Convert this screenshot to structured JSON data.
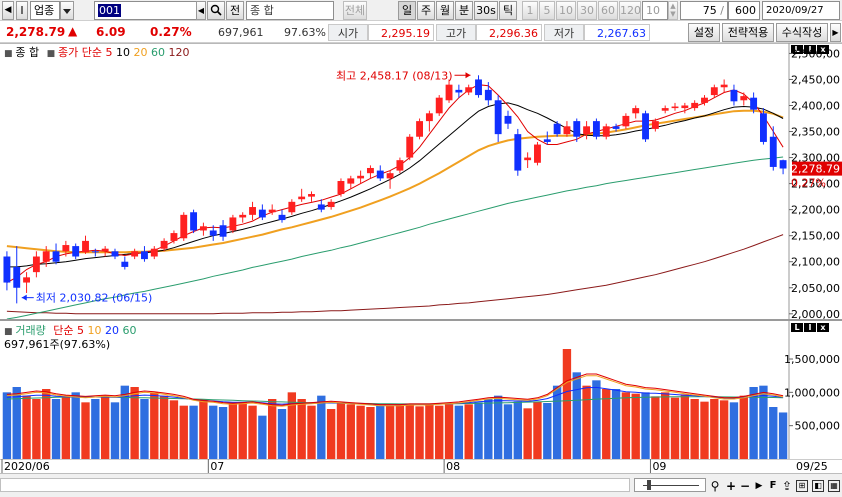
{
  "toolbar": {
    "mode_label": "I",
    "market_label": "업종",
    "code": "001",
    "name_field": "종          합",
    "all_label": "전체",
    "periods": [
      "일",
      "주",
      "월",
      "분",
      "30s",
      "틱"
    ],
    "intervals": [
      "1",
      "5",
      "10",
      "30",
      "60",
      "120"
    ],
    "count_stepper": "10",
    "ratio_field": "75",
    "bars_field": "600",
    "date_field": "2020/09/27"
  },
  "quote": {
    "price": "2,278.79",
    "change": "6.09",
    "change_pct": "0.27%",
    "volume": "697,961",
    "volume_pct": "97.63%",
    "open_label": "시가",
    "open": "2,295.19",
    "high_label": "고가",
    "high": "2,296.36",
    "low_label": "저가",
    "low": "2,267.63"
  },
  "actions": {
    "settings": "설정",
    "apply_strategy": "전략적용",
    "write_formula": "수식작성"
  },
  "price_panel": {
    "legend_title": "종     합",
    "legend_ma": "종가 단순",
    "ma_periods": [
      "5",
      "10",
      "20",
      "60",
      "120"
    ],
    "high_note": "최고 2,458.17 (08/13)",
    "low_note": "최저 2,030.82 (06/15)",
    "last_price_tag": "2,278.79",
    "last_pct_tag": "0.27%",
    "y_ticks": [
      "2,500,00",
      "2,450,00",
      "2,400,00",
      "2,350,00",
      "2,300,00",
      "2,250,00",
      "2,200,00",
      "2,150,00",
      "2,100,00",
      "2,050,00",
      "2,000,00"
    ]
  },
  "volume_panel": {
    "legend_title": "거래량",
    "legend_ma": "단순",
    "ma_periods": [
      "5",
      "10",
      "20",
      "60"
    ],
    "current_note": "697,961주(97.63%)",
    "y_ticks": [
      "1,500,000",
      "1,000,000",
      "500,000"
    ]
  },
  "x_axis": {
    "labels": [
      "2020/06",
      "07",
      "08",
      "09"
    ],
    "end_label": "09/25"
  },
  "colors": {
    "up": "#ff2020",
    "down": "#1030ff",
    "ma5": "#e00000",
    "ma10": "#000000",
    "ma20": "#f0a020",
    "ma60": "#2a9d6e",
    "ma120": "#8b1a1a",
    "vol_up": "#f03a20",
    "vol_down": "#2f6ee0"
  },
  "chart_data": {
    "type": "candlestick",
    "ylim": [
      1990,
      2520
    ],
    "candles": [
      [
        2110,
        2120,
        2045,
        2060
      ],
      [
        2090,
        2130,
        2020,
        2050
      ],
      [
        2060,
        2080,
        2040,
        2070
      ],
      [
        2080,
        2120,
        2070,
        2110
      ],
      [
        2100,
        2130,
        2090,
        2120
      ],
      [
        2120,
        2135,
        2095,
        2100
      ],
      [
        2120,
        2140,
        2110,
        2132
      ],
      [
        2130,
        2135,
        2105,
        2110
      ],
      [
        2118,
        2150,
        2115,
        2140
      ],
      [
        2120,
        2125,
        2110,
        2118
      ],
      [
        2120,
        2130,
        2110,
        2125
      ],
      [
        2120,
        2125,
        2105,
        2110
      ],
      [
        2100,
        2110,
        2085,
        2090
      ],
      [
        2110,
        2125,
        2105,
        2120
      ],
      [
        2120,
        2130,
        2100,
        2105
      ],
      [
        2110,
        2130,
        2105,
        2125
      ],
      [
        2125,
        2145,
        2120,
        2140
      ],
      [
        2140,
        2160,
        2135,
        2155
      ],
      [
        2145,
        2195,
        2140,
        2190
      ],
      [
        2195,
        2200,
        2155,
        2160
      ],
      [
        2160,
        2175,
        2150,
        2168
      ],
      [
        2160,
        2170,
        2140,
        2150
      ],
      [
        2170,
        2180,
        2140,
        2148
      ],
      [
        2160,
        2190,
        2155,
        2185
      ],
      [
        2185,
        2195,
        2175,
        2190
      ],
      [
        2190,
        2215,
        2180,
        2205
      ],
      [
        2200,
        2210,
        2180,
        2185
      ],
      [
        2195,
        2210,
        2190,
        2200
      ],
      [
        2190,
        2200,
        2175,
        2180
      ],
      [
        2195,
        2220,
        2190,
        2215
      ],
      [
        2220,
        2240,
        2215,
        2225
      ],
      [
        2225,
        2235,
        2215,
        2230
      ],
      [
        2210,
        2220,
        2195,
        2200
      ],
      [
        2205,
        2220,
        2200,
        2215
      ],
      [
        2230,
        2260,
        2225,
        2255
      ],
      [
        2250,
        2265,
        2240,
        2260
      ],
      [
        2260,
        2275,
        2250,
        2265
      ],
      [
        2270,
        2285,
        2260,
        2280
      ],
      [
        2275,
        2285,
        2255,
        2260
      ],
      [
        2260,
        2275,
        2240,
        2270
      ],
      [
        2275,
        2300,
        2270,
        2295
      ],
      [
        2300,
        2345,
        2295,
        2340
      ],
      [
        2340,
        2375,
        2335,
        2370
      ],
      [
        2370,
        2390,
        2350,
        2385
      ],
      [
        2385,
        2420,
        2380,
        2415
      ],
      [
        2410,
        2450,
        2405,
        2440
      ],
      [
        2430,
        2440,
        2415,
        2425
      ],
      [
        2425,
        2440,
        2420,
        2435
      ],
      [
        2450,
        2458,
        2415,
        2420
      ],
      [
        2430,
        2445,
        2400,
        2410
      ],
      [
        2410,
        2420,
        2330,
        2345
      ],
      [
        2380,
        2390,
        2355,
        2365
      ],
      [
        2345,
        2355,
        2265,
        2275
      ],
      [
        2295,
        2310,
        2280,
        2300
      ],
      [
        2290,
        2330,
        2285,
        2325
      ],
      [
        2335,
        2350,
        2325,
        2330
      ],
      [
        2365,
        2370,
        2340,
        2345
      ],
      [
        2345,
        2370,
        2340,
        2360
      ],
      [
        2370,
        2375,
        2330,
        2340
      ],
      [
        2345,
        2370,
        2335,
        2360
      ],
      [
        2370,
        2375,
        2335,
        2340
      ],
      [
        2340,
        2365,
        2335,
        2360
      ],
      [
        2360,
        2365,
        2350,
        2355
      ],
      [
        2360,
        2385,
        2355,
        2380
      ],
      [
        2385,
        2400,
        2375,
        2395
      ],
      [
        2385,
        2390,
        2330,
        2335
      ],
      [
        2355,
        2375,
        2350,
        2370
      ],
      [
        2390,
        2400,
        2385,
        2395
      ],
      [
        2395,
        2405,
        2390,
        2398
      ],
      [
        2395,
        2405,
        2385,
        2400
      ],
      [
        2395,
        2410,
        2390,
        2405
      ],
      [
        2405,
        2420,
        2400,
        2415
      ],
      [
        2420,
        2440,
        2415,
        2435
      ],
      [
        2435,
        2450,
        2425,
        2440
      ],
      [
        2430,
        2440,
        2400,
        2408
      ],
      [
        2410,
        2425,
        2400,
        2418
      ],
      [
        2415,
        2425,
        2385,
        2392
      ],
      [
        2385,
        2395,
        2325,
        2330
      ],
      [
        2340,
        2360,
        2275,
        2282
      ],
      [
        2295,
        2296,
        2268,
        2279
      ]
    ],
    "ma5": [
      2060,
      2070,
      2085,
      2095,
      2100,
      2110,
      2115,
      2118,
      2120,
      2122,
      2120,
      2115,
      2112,
      2115,
      2118,
      2122,
      2130,
      2140,
      2150,
      2158,
      2165,
      2166,
      2165,
      2168,
      2172,
      2178,
      2188,
      2195,
      2200,
      2205,
      2210,
      2214,
      2218,
      2224,
      2230,
      2240,
      2250,
      2260,
      2268,
      2275,
      2285,
      2300,
      2320,
      2345,
      2370,
      2395,
      2415,
      2430,
      2440,
      2438,
      2420,
      2400,
      2378,
      2350,
      2335,
      2325,
      2325,
      2330,
      2335,
      2345,
      2350,
      2355,
      2360,
      2365,
      2370,
      2370,
      2372,
      2378,
      2385,
      2390,
      2398,
      2405,
      2415,
      2425,
      2430,
      2422,
      2405,
      2380,
      2350,
      2320
    ],
    "ma10": [
      2090,
      2090,
      2092,
      2095,
      2096,
      2098,
      2100,
      2103,
      2106,
      2108,
      2110,
      2112,
      2114,
      2116,
      2117,
      2119,
      2122,
      2127,
      2133,
      2139,
      2145,
      2150,
      2154,
      2158,
      2162,
      2167,
      2172,
      2177,
      2182,
      2187,
      2193,
      2198,
      2204,
      2210,
      2217,
      2224,
      2232,
      2240,
      2249,
      2258,
      2268,
      2280,
      2294,
      2310,
      2326,
      2342,
      2358,
      2374,
      2389,
      2398,
      2403,
      2405,
      2400,
      2392,
      2385,
      2376,
      2366,
      2356,
      2346,
      2343,
      2342,
      2342,
      2344,
      2347,
      2351,
      2354,
      2358,
      2362,
      2367,
      2371,
      2376,
      2380,
      2386,
      2392,
      2397,
      2398,
      2397,
      2393,
      2385,
      2375
    ],
    "ma20": [
      2130,
      2128,
      2126,
      2124,
      2122,
      2120,
      2119,
      2118,
      2118,
      2118,
      2118,
      2118,
      2118,
      2119,
      2119,
      2120,
      2121,
      2123,
      2125,
      2127,
      2130,
      2133,
      2136,
      2140,
      2144,
      2148,
      2152,
      2157,
      2162,
      2166,
      2171,
      2176,
      2181,
      2186,
      2192,
      2198,
      2204,
      2211,
      2218,
      2225,
      2233,
      2241,
      2250,
      2260,
      2270,
      2281,
      2292,
      2303,
      2314,
      2322,
      2328,
      2333,
      2336,
      2338,
      2340,
      2341,
      2342,
      2342,
      2343,
      2344,
      2346,
      2348,
      2351,
      2354,
      2358,
      2362,
      2365,
      2368,
      2371,
      2374,
      2377,
      2380,
      2383,
      2386,
      2389,
      2390,
      2390,
      2388,
      2384,
      2377
    ],
    "ma60": [
      1990,
      1993,
      1997,
      2001,
      2005,
      2009,
      2013,
      2017,
      2021,
      2025,
      2029,
      2032,
      2036,
      2040,
      2043,
      2047,
      2051,
      2055,
      2059,
      2063,
      2067,
      2072,
      2076,
      2080,
      2084,
      2089,
      2093,
      2097,
      2101,
      2105,
      2110,
      2114,
      2118,
      2122,
      2127,
      2131,
      2136,
      2141,
      2146,
      2151,
      2156,
      2161,
      2166,
      2172,
      2177,
      2182,
      2187,
      2192,
      2197,
      2202,
      2207,
      2212,
      2216,
      2220,
      2224,
      2228,
      2232,
      2236,
      2239,
      2243,
      2246,
      2250,
      2253,
      2256,
      2259,
      2262,
      2265,
      2268,
      2271,
      2274,
      2277,
      2280,
      2283,
      2286,
      2289,
      2292,
      2295,
      2297,
      2299,
      2301
    ],
    "ma120": [
      2005,
      2004,
      2003,
      2002,
      2002,
      2001,
      2001,
      2000,
      2000,
      2000,
      2000,
      2000,
      2000,
      2000,
      2000,
      2000,
      2000,
      2000,
      2000,
      2000,
      2000,
      2000,
      2001,
      2001,
      2001,
      2002,
      2002,
      2002,
      2003,
      2003,
      2004,
      2004,
      2005,
      2006,
      2006,
      2007,
      2008,
      2009,
      2010,
      2011,
      2012,
      2013,
      2014,
      2015,
      2017,
      2018,
      2020,
      2021,
      2023,
      2025,
      2027,
      2029,
      2031,
      2033,
      2035,
      2037,
      2040,
      2043,
      2046,
      2049,
      2052,
      2055,
      2059,
      2063,
      2067,
      2071,
      2075,
      2080,
      2085,
      2090,
      2095,
      2100,
      2106,
      2112,
      2118,
      2124,
      2131,
      2138,
      2145,
      2152
    ],
    "volume": [
      1000000,
      1080000,
      950000,
      900000,
      1050000,
      900000,
      950000,
      1000000,
      850000,
      900000,
      950000,
      850000,
      1100000,
      1080000,
      900000,
      1000000,
      950000,
      880000,
      800000,
      800000,
      900000,
      800000,
      780000,
      850000,
      850000,
      800000,
      650000,
      900000,
      750000,
      1000000,
      900000,
      800000,
      950000,
      750000,
      850000,
      820000,
      800000,
      780000,
      800000,
      800000,
      820000,
      810000,
      790000,
      830000,
      800000,
      820000,
      800000,
      820000,
      850000,
      900000,
      950000,
      820000,
      860000,
      760000,
      860000,
      840000,
      1100000,
      1650000,
      1300000,
      1100000,
      1180000,
      1050000,
      1050000,
      1000000,
      980000,
      1000000,
      940000,
      1000000,
      920000,
      970000,
      900000,
      860000,
      900000,
      880000,
      850000,
      950000,
      1080000,
      1100000,
      780000,
      697961
    ],
    "vol_ma_short": [
      950000,
      960000,
      980000,
      1000000,
      990000,
      960000,
      940000,
      930000,
      920000,
      930000,
      940000,
      930000,
      950000,
      980000,
      1000000,
      990000,
      970000,
      950000,
      920000,
      880000,
      860000,
      850000,
      830000,
      820000,
      830000,
      840000,
      820000,
      800000,
      790000,
      810000,
      820000,
      830000,
      840000,
      850000,
      840000,
      830000,
      820000,
      810000,
      800000,
      800000,
      800000,
      810000,
      810000,
      810000,
      820000,
      830000,
      840000,
      860000,
      880000,
      900000,
      910000,
      900000,
      890000,
      880000,
      900000,
      950000,
      1050000,
      1150000,
      1200000,
      1250000,
      1250000,
      1200000,
      1150000,
      1100000,
      1080000,
      1050000,
      1040000,
      1020000,
      1000000,
      980000,
      960000,
      940000,
      920000,
      900000,
      900000,
      920000,
      950000,
      980000,
      960000,
      930000
    ],
    "vol_ma_long": [
      900000,
      905000,
      910000,
      915000,
      920000,
      925000,
      928000,
      930000,
      930000,
      930000,
      928000,
      925000,
      922000,
      920000,
      918000,
      915000,
      912000,
      908000,
      904000,
      900000,
      895000,
      890000,
      885000,
      880000,
      875000,
      870000,
      865000,
      860000,
      856000,
      852000,
      848000,
      845000,
      842000,
      840000,
      838000,
      836000,
      834000,
      832000,
      830000,
      828000,
      827000,
      826000,
      826000,
      826000,
      827000,
      828000,
      830000,
      832000,
      835000,
      838000,
      841000,
      845000,
      849000,
      853000,
      857000,
      862000,
      868000,
      875000,
      882000,
      890000,
      898000,
      905000,
      912000,
      918000,
      923000,
      927000,
      930000,
      932000,
      934000,
      935000,
      935000,
      935000,
      934000,
      932000,
      930000,
      928000,
      926000,
      924000,
      922000,
      920000
    ]
  }
}
